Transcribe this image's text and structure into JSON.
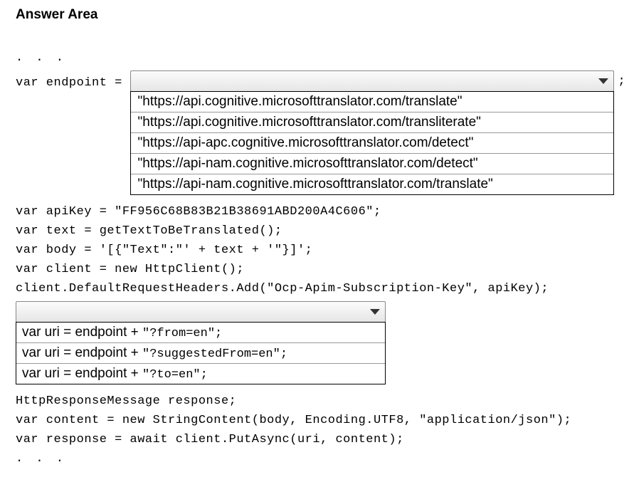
{
  "title": "Answer Area",
  "ellipsis": ". . .",
  "codeLines": {
    "endpointLabel": "var endpoint = ",
    "afterEndpointSemi": " ;",
    "apiKey": "var apiKey = \"FF956C68B83B21B38691ABD200A4C606\";",
    "text": "var text = getTextToBeTranslated();",
    "body": "var body = '[{\"Text\":\"' + text + '\"}]';",
    "client": "var client = new HttpClient();",
    "header": "client.DefaultRequestHeaders.Add(\"Ocp-Apim-Subscription-Key\", apiKey);",
    "responseDecl": "HttpResponseMessage response;",
    "content": "var content = new StringContent(body, Encoding.UTF8, \"application/json\");",
    "response": "var response = await client.PutAsync(uri, content);"
  },
  "dropdown1": {
    "options": [
      "\"https://api.cognitive.microsofttranslator.com/translate\"",
      "\"https://api.cognitive.microsofttranslator.com/transliterate\"",
      "\"https://api-apc.cognitive.microsofttranslator.com/detect\"",
      "\"https://api-nam.cognitive.microsofttranslator.com/detect\"",
      "\"https://api-nam.cognitive.microsofttranslator.com/translate\""
    ]
  },
  "dropdown2": {
    "options": [
      {
        "prefix": "var uri = endpoint + ",
        "suffix": "\"?from=en\";"
      },
      {
        "prefix": "var uri = endpoint + ",
        "suffix": "\"?suggestedFrom=en\";"
      },
      {
        "prefix": "var uri = endpoint + ",
        "suffix": "\"?to=en\";"
      }
    ]
  }
}
